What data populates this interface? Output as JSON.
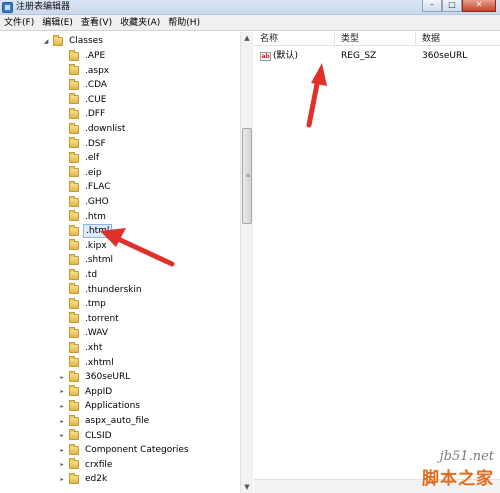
{
  "window": {
    "title": "注册表编辑器",
    "minimize": "–",
    "maximize": "□",
    "close": "✕"
  },
  "menu": [
    "文件(F)",
    "编辑(E)",
    "查看(V)",
    "收藏夹(A)",
    "帮助(H)"
  ],
  "tree": {
    "parent": "Classes",
    "items": [
      ".APE",
      ".aspx",
      ".CDA",
      ".CUE",
      ".DFF",
      ".downlist",
      ".DSF",
      ".elf",
      ".eip",
      ".FLAC",
      ".GHO",
      ".htm",
      ".html",
      ".kipx",
      ".shtml",
      ".td",
      ".thunderskin",
      ".tmp",
      ".torrent",
      ".WAV",
      ".xht",
      ".xhtml",
      "360seURL",
      "AppID",
      "Applications",
      "aspx_auto_file",
      "CLSID",
      "Component Categories",
      "crxfile",
      "ed2k"
    ],
    "selected": ".html",
    "expand_glyph": "▸",
    "collapse_glyph": "◢"
  },
  "columns": {
    "name": "名称",
    "type": "类型",
    "data": "数据"
  },
  "values": [
    {
      "icon": "ab",
      "name": "(默认)",
      "type": "REG_SZ",
      "data": "360seURL"
    }
  ],
  "scrollbar": {
    "up": "▲",
    "down": "▼",
    "grip": "≡"
  },
  "watermark": {
    "line1": "jb51.net",
    "line2": "脚本之家"
  },
  "colors": {
    "arrow": "#e0302a",
    "selection": "#dbeafc",
    "folder": "#e9c866"
  }
}
